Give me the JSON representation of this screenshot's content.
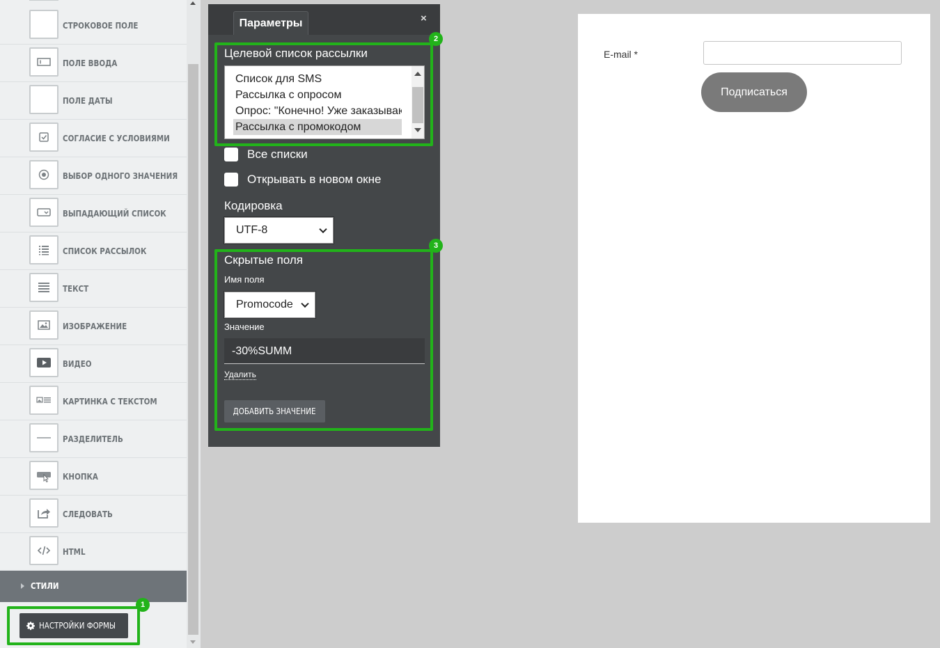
{
  "sidebar": {
    "items": [
      {
        "label": "СТРОКОВОЕ ПОЛЕ",
        "icon": "blank-icon"
      },
      {
        "label": "ПОЛЕ ВВОДА",
        "icon": "text-input-icon"
      },
      {
        "label": "ПОЛЕ ДАТЫ",
        "icon": "blank-icon"
      },
      {
        "label": "СОГЛАСИЕ С УСЛОВИЯМИ",
        "icon": "checkbox-icon"
      },
      {
        "label": "ВЫБОР ОДНОГО ЗНАЧЕНИЯ",
        "icon": "radio-icon"
      },
      {
        "label": "ВЫПАДАЮЩИЙ СПИСОК",
        "icon": "dropdown-icon"
      },
      {
        "label": "СПИСОК РАССЫЛОК",
        "icon": "list-icon"
      },
      {
        "label": "ТЕКСТ",
        "icon": "text-lines-icon"
      },
      {
        "label": "ИЗОБРАЖЕНИЕ",
        "icon": "image-icon"
      },
      {
        "label": "ВИДЕО",
        "icon": "video-icon"
      },
      {
        "label": "КАРТИНКА С ТЕКСТОМ",
        "icon": "image-text-icon"
      },
      {
        "label": "РАЗДЕЛИТЕЛЬ",
        "icon": "divider-icon"
      },
      {
        "label": "КНОПКА",
        "icon": "button-icon"
      },
      {
        "label": "СЛЕДОВАТЬ",
        "icon": "share-icon"
      },
      {
        "label": "HTML",
        "icon": "code-icon"
      }
    ],
    "styles_label": "СТИЛИ",
    "settings_button": "НАСТРОЙКИ ФОРМЫ"
  },
  "annotations": [
    "1",
    "2",
    "3"
  ],
  "panel": {
    "tab_label": "Параметры",
    "close_label": "×",
    "target_list_label": "Целевой список рассылки",
    "list_options": [
      "Список для SMS",
      "Рассылка с опросом",
      "Опрос: \"Конечно! Уже заказываю!\"",
      "Рассылка с промокодом"
    ],
    "selected_option_index": 3,
    "all_lists_label": "Все списки",
    "all_lists_checked": false,
    "open_new_window_label": "Открывать в новом окне",
    "open_new_window_checked": false,
    "encoding_label": "Кодировка",
    "encoding_value": "UTF-8",
    "hidden_fields_label": "Скрытые поля",
    "field_name_label": "Имя поля",
    "field_name_value": "Promocode",
    "value_label": "Значение",
    "value_text": "-30%SUMM",
    "delete_link": "Удалить",
    "add_value_button": "ДОБАВИТЬ ЗНАЧЕНИЕ"
  },
  "preview": {
    "email_label": "E-mail *",
    "email_value": "",
    "subscribe_button": "Подписаться"
  },
  "colors": {
    "highlight_green": "#22b31a",
    "panel_bg": "#444749",
    "button_gray": "#7a7a7a"
  }
}
